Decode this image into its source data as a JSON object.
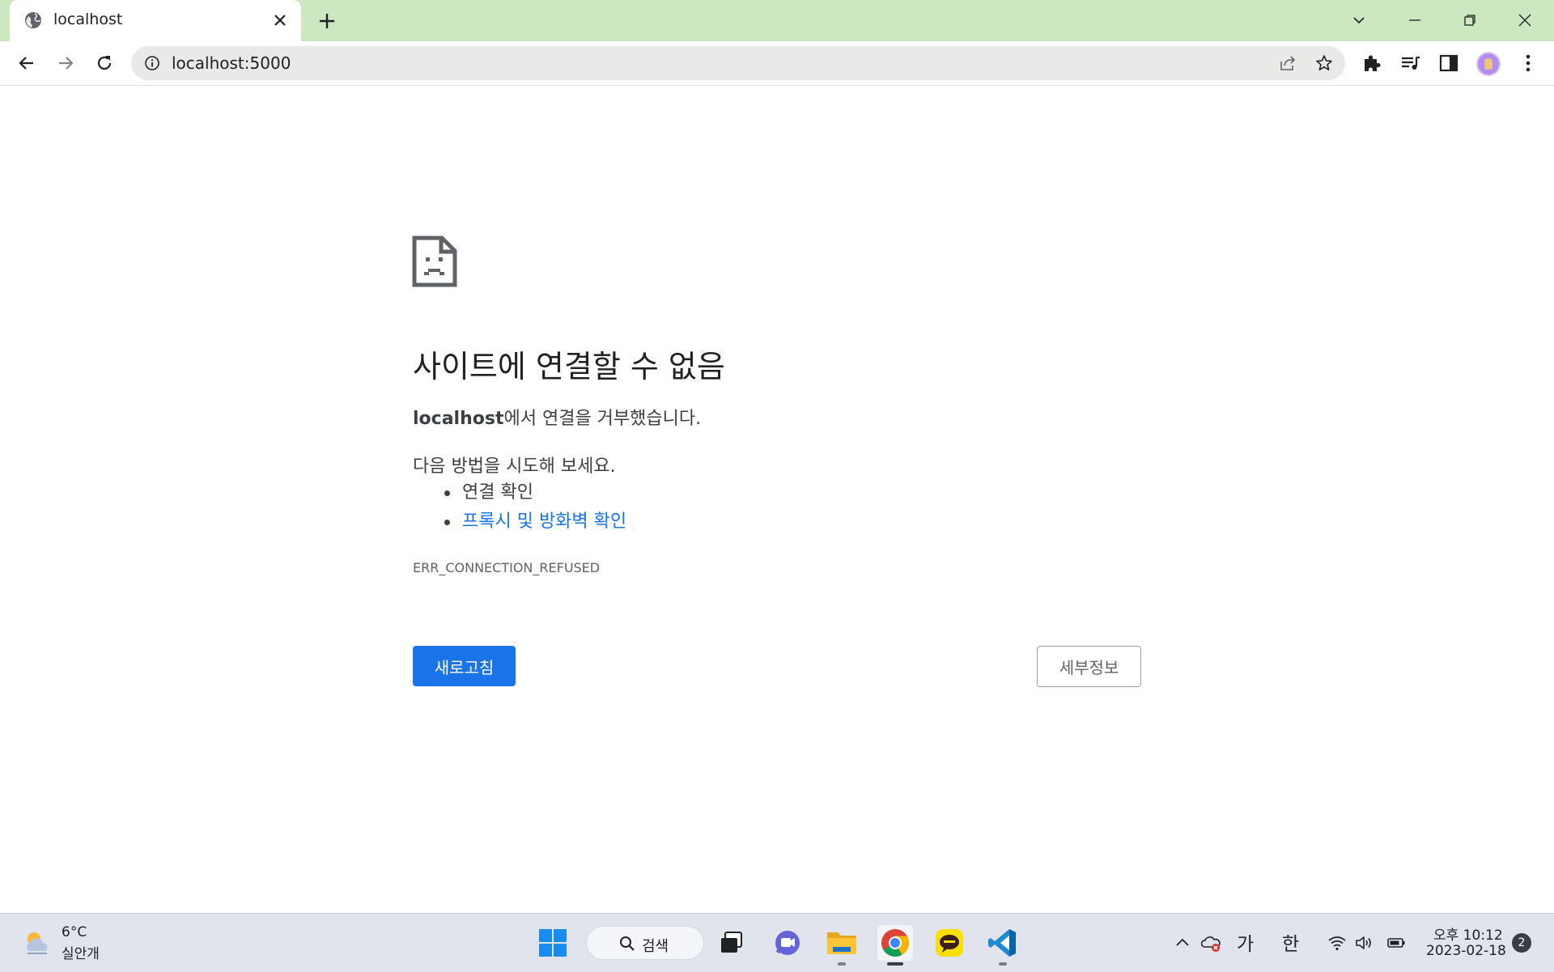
{
  "browser": {
    "tab": {
      "title": "localhost"
    },
    "address_bar": {
      "url": "localhost:5000"
    }
  },
  "error_page": {
    "title": "사이트에 연결할 수 없음",
    "host": "localhost",
    "message_suffix": "에서 연결을 거부했습니다.",
    "try_title": "다음 방법을 시도해 보세요.",
    "suggestions": [
      {
        "label": "연결 확인"
      },
      {
        "label": "프록시 및 방화벽 확인"
      }
    ],
    "error_code": "ERR_CONNECTION_REFUSED",
    "reload_label": "새로고침",
    "details_label": "세부정보"
  },
  "taskbar": {
    "weather": {
      "temp": "6°C",
      "condition": "실안개"
    },
    "search_label": "검색",
    "ime_primary": "가",
    "ime_language": "한",
    "clock": {
      "time": "오후 10:12",
      "date": "2023-02-18"
    },
    "notification_count": "2"
  },
  "colors": {
    "titlebar": "#cce8c0",
    "link": "#1a73e8",
    "primary_button": "#1a73e8",
    "taskbar": "#e1e4ec"
  }
}
